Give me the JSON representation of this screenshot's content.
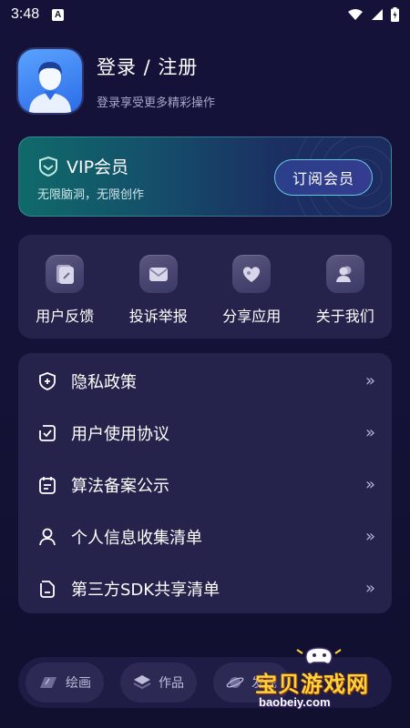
{
  "status_bar": {
    "time": "3:48",
    "badge": "A"
  },
  "profile": {
    "title": "登录 / 注册",
    "subtitle": "登录享受更多精彩操作"
  },
  "vip": {
    "title": "VIP会员",
    "subtitle": "无限脑洞，无限创作",
    "button": "订阅会员"
  },
  "quick_actions": [
    {
      "label": "用户反馈",
      "icon": "feedback-icon"
    },
    {
      "label": "投诉举报",
      "icon": "mail-icon"
    },
    {
      "label": "分享应用",
      "icon": "share-icon"
    },
    {
      "label": "关于我们",
      "icon": "people-icon"
    }
  ],
  "menu": [
    {
      "label": "隐私政策",
      "icon": "shield-plus-icon",
      "chevron": "»"
    },
    {
      "label": "用户使用协议",
      "icon": "agreement-icon",
      "chevron": "»"
    },
    {
      "label": "算法备案公示",
      "icon": "calendar-doc-icon",
      "chevron": "»"
    },
    {
      "label": "个人信息收集清单",
      "icon": "person-icon",
      "chevron": "»"
    },
    {
      "label": "第三方SDK共享清单",
      "icon": "document-icon",
      "chevron": "»"
    }
  ],
  "bottom_nav": [
    {
      "label": "绘画",
      "icon": "paint-icon"
    },
    {
      "label": "作品",
      "icon": "layers-icon"
    },
    {
      "label": "发现",
      "icon": "planet-icon"
    }
  ],
  "watermark": {
    "text": "宝贝游戏网",
    "url": "baobeiy.com"
  },
  "colors": {
    "background": "#15123a",
    "card": "#25234c",
    "vip_teal": "#0f6a6a",
    "vip_button_border": "#64c9e6"
  }
}
